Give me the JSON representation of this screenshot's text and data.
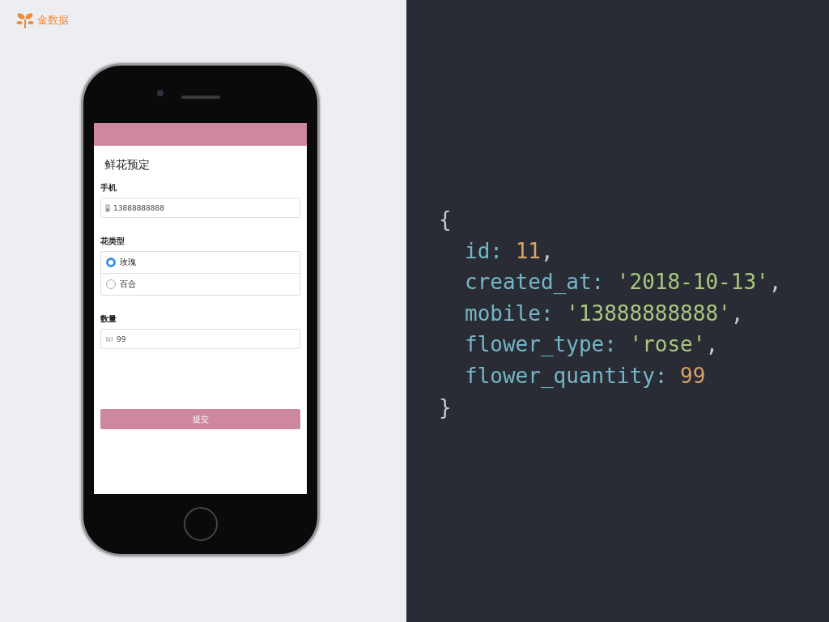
{
  "brand": {
    "name": "金数据"
  },
  "app": {
    "title": "鲜花预定",
    "fields": [
      {
        "kind": "text",
        "label": "手机",
        "value": "13888888888"
      },
      {
        "kind": "radio",
        "label": "花类型",
        "options": [
          {
            "label": "玫瑰",
            "selected": true
          },
          {
            "label": "百合",
            "selected": false
          }
        ]
      },
      {
        "kind": "number",
        "label": "数量",
        "value": "99"
      }
    ],
    "submit": "提交"
  },
  "code": {
    "lines": [
      {
        "indented": false,
        "tokens": [
          {
            "kind": "punct",
            "text": "{"
          }
        ]
      },
      {
        "indented": true,
        "tokens": [
          {
            "kind": "key",
            "text": "id: "
          },
          {
            "kind": "number",
            "text": "11"
          },
          {
            "kind": "punct",
            "text": ","
          }
        ]
      },
      {
        "indented": true,
        "tokens": [
          {
            "kind": "key",
            "text": "created_at: "
          },
          {
            "kind": "string",
            "text": "'2018-10-13'"
          },
          {
            "kind": "punct",
            "text": ","
          }
        ]
      },
      {
        "indented": true,
        "tokens": [
          {
            "kind": "key",
            "text": "mobile: "
          },
          {
            "kind": "string",
            "text": "'13888888888'"
          },
          {
            "kind": "punct",
            "text": ","
          }
        ]
      },
      {
        "indented": true,
        "tokens": [
          {
            "kind": "key",
            "text": "flower_type: "
          },
          {
            "kind": "string",
            "text": "'rose'"
          },
          {
            "kind": "punct",
            "text": ","
          }
        ]
      },
      {
        "indented": true,
        "tokens": [
          {
            "kind": "key",
            "text": "flower_quantity: "
          },
          {
            "kind": "number",
            "text": "99"
          }
        ]
      },
      {
        "indented": false,
        "tokens": [
          {
            "kind": "punct",
            "text": "}"
          }
        ]
      }
    ]
  }
}
